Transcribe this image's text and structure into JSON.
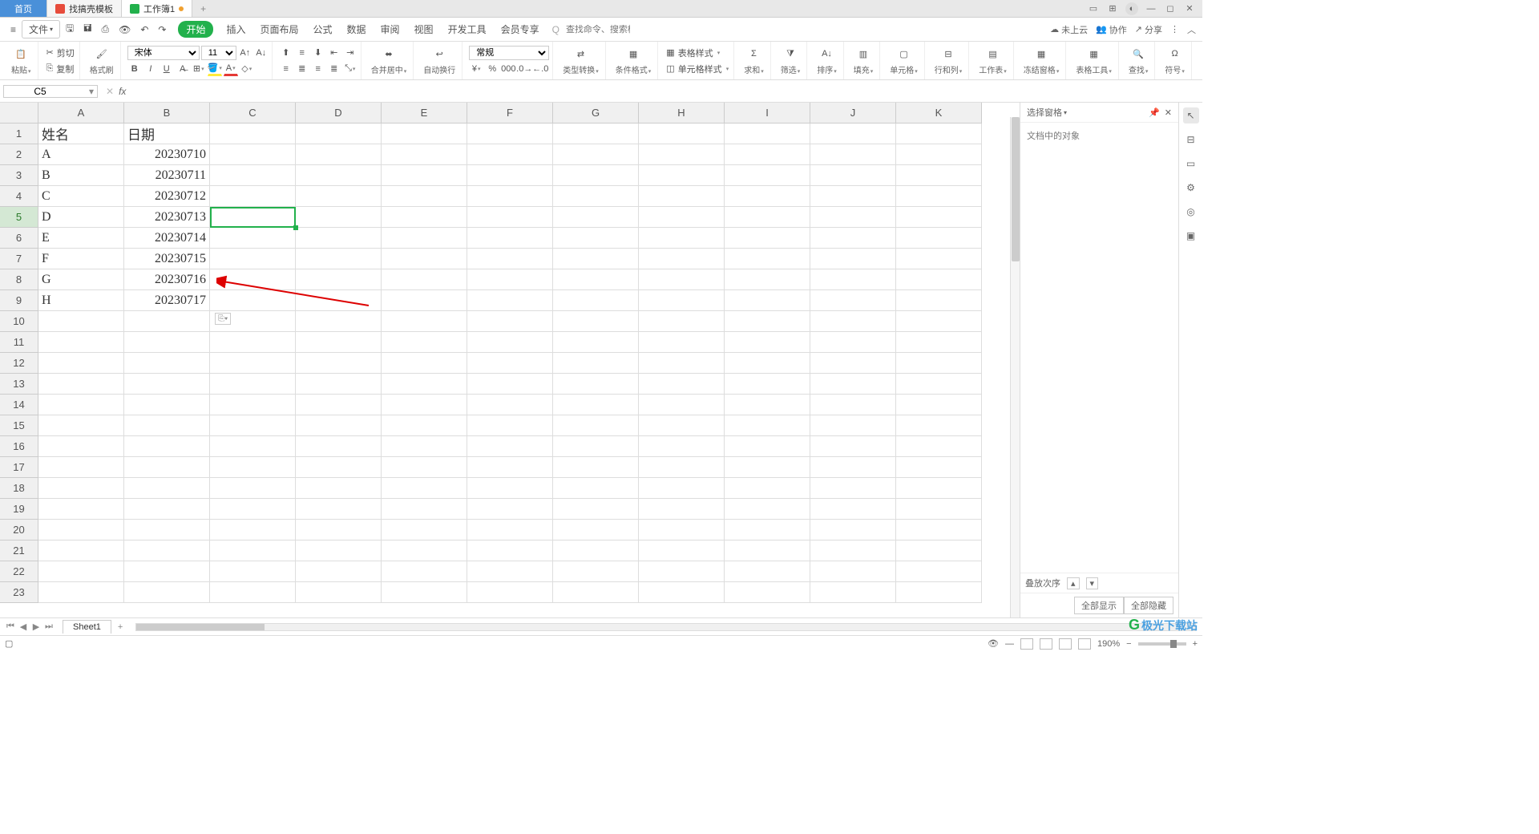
{
  "titlebar": {
    "home": "首页",
    "tab1": "找搞壳模板",
    "tab2": "工作簿1"
  },
  "menu": {
    "file": "文件",
    "tabs": [
      "开始",
      "插入",
      "页面布局",
      "公式",
      "数据",
      "审阅",
      "视图",
      "开发工具",
      "会员专享"
    ],
    "search_placeholder": "查找命令、搜索模板",
    "search_icon_hint": "Q 查找命令",
    "cloud": "未上云",
    "collab": "协作",
    "share": "分享"
  },
  "ribbon": {
    "paste": "粘贴",
    "cut": "剪切",
    "copy": "复制",
    "format_painter": "格式刷",
    "font_name": "宋体",
    "font_size": "11",
    "merge": "合并居中",
    "wrap": "自动换行",
    "number_format": "常规",
    "type_conv": "类型转换",
    "cond_format": "条件格式",
    "cell_style": "单元格样式",
    "table_style": "表格样式",
    "sum": "求和",
    "filter": "筛选",
    "sort": "排序",
    "fill": "填充",
    "cell": "单元格",
    "rowcol": "行和列",
    "worksheet": "工作表",
    "freeze": "冻结窗格",
    "table_tools": "表格工具",
    "find": "查找",
    "symbol": "符号"
  },
  "namebox": "C5",
  "fx": "fx",
  "columns": [
    "A",
    "B",
    "C",
    "D",
    "E",
    "F",
    "G",
    "H",
    "I",
    "J",
    "K"
  ],
  "rows": [
    "1",
    "2",
    "3",
    "4",
    "5",
    "6",
    "7",
    "8",
    "9",
    "10",
    "11",
    "12",
    "13",
    "14",
    "15",
    "16",
    "17",
    "18",
    "19",
    "20",
    "21",
    "22",
    "23"
  ],
  "data": {
    "A1": "姓名",
    "B1": "日期",
    "A2": "A",
    "B2": "20230710",
    "A3": "B",
    "B3": "20230711",
    "A4": "C",
    "B4": "20230712",
    "A5": "D",
    "B5": "20230713",
    "A6": "E",
    "B6": "20230714",
    "A7": "F",
    "B7": "20230715",
    "A8": "G",
    "B8": "20230716",
    "A9": "H",
    "B9": "20230717"
  },
  "paste_indicator": "⎘▾",
  "panel": {
    "title": "选择窗格",
    "body": "文档中的对象",
    "order": "叠放次序",
    "show_all": "全部显示",
    "hide_all": "全部隐藏"
  },
  "sheet": {
    "name": "Sheet1"
  },
  "status": {
    "zoom": "190%",
    "brand": "极光下载站"
  }
}
